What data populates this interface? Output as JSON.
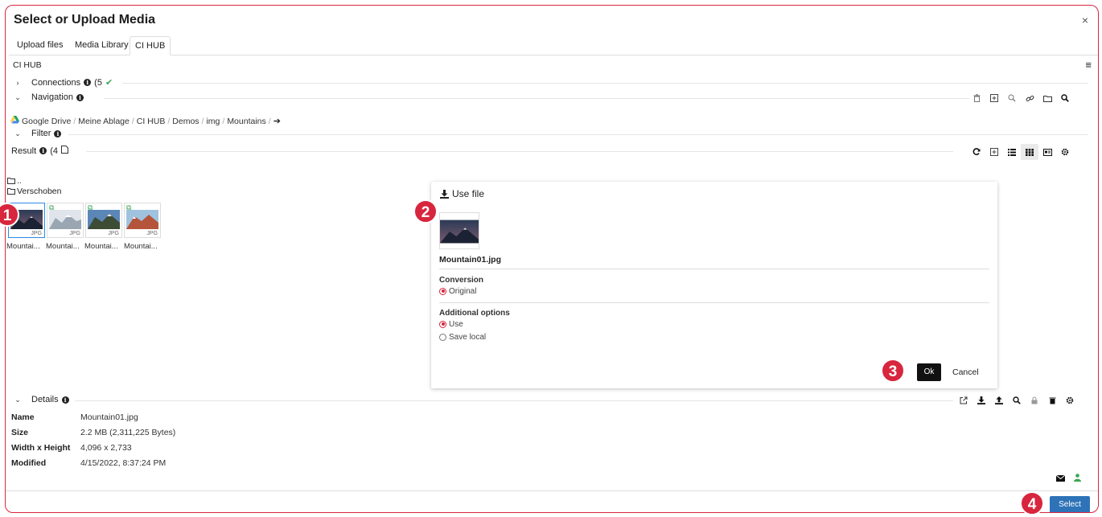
{
  "window": {
    "title": "Select or Upload Media",
    "close": "×"
  },
  "tabs": [
    {
      "label": "Upload files"
    },
    {
      "label": "Media Library"
    },
    {
      "label": "CI HUB"
    }
  ],
  "cihub": {
    "heading": "CI HUB",
    "menu": "≡",
    "connections": {
      "label": "Connections",
      "count_text": "(5",
      "check": "✔"
    },
    "navigation": {
      "label": "Navigation"
    },
    "breadcrumb": [
      "Google Drive",
      "Meine Ablage",
      "CI HUB",
      "Demos",
      "img",
      "Mountains"
    ],
    "breadcrumb_sep": "/",
    "breadcrumb_go": "➔",
    "filter": {
      "label": "Filter"
    },
    "result": {
      "label": "Result",
      "count_text": "(4"
    },
    "folders": [
      {
        "label": ".."
      },
      {
        "label": "Verschoben"
      }
    ],
    "thumbnails": [
      {
        "label": "Mountai...",
        "type": "JPG"
      },
      {
        "label": "Mountai...",
        "type": "JPG"
      },
      {
        "label": "Mountai...",
        "type": "JPG"
      },
      {
        "label": "Mountai...",
        "type": "JPG"
      }
    ]
  },
  "dialog": {
    "title": "Use file",
    "filename": "Mountain01.jpg",
    "conversion_label": "Conversion",
    "conversion_options": [
      {
        "label": "Original",
        "selected": true
      }
    ],
    "additional_label": "Additional options",
    "additional_options": [
      {
        "label": "Use",
        "selected": true
      },
      {
        "label": "Save local",
        "selected": false
      }
    ],
    "ok": "Ok",
    "cancel": "Cancel"
  },
  "details": {
    "label": "Details",
    "rows": [
      {
        "key": "Name",
        "value": "Mountain01.jpg"
      },
      {
        "key": "Size",
        "value": "2.2 MB (2,311,225 Bytes)"
      },
      {
        "key": "Width x Height",
        "value": "4,096 x 2,733"
      },
      {
        "key": "Modified",
        "value": "4/15/2022, 8:37:24 PM"
      }
    ]
  },
  "footer": {
    "select": "Select"
  },
  "badges": [
    "1",
    "2",
    "3",
    "4"
  ],
  "colors": {
    "accent_red": "#d7263d",
    "select_blue": "#2e73b8",
    "selected_border": "#2d8ae8",
    "check_green": "#3aa655"
  }
}
